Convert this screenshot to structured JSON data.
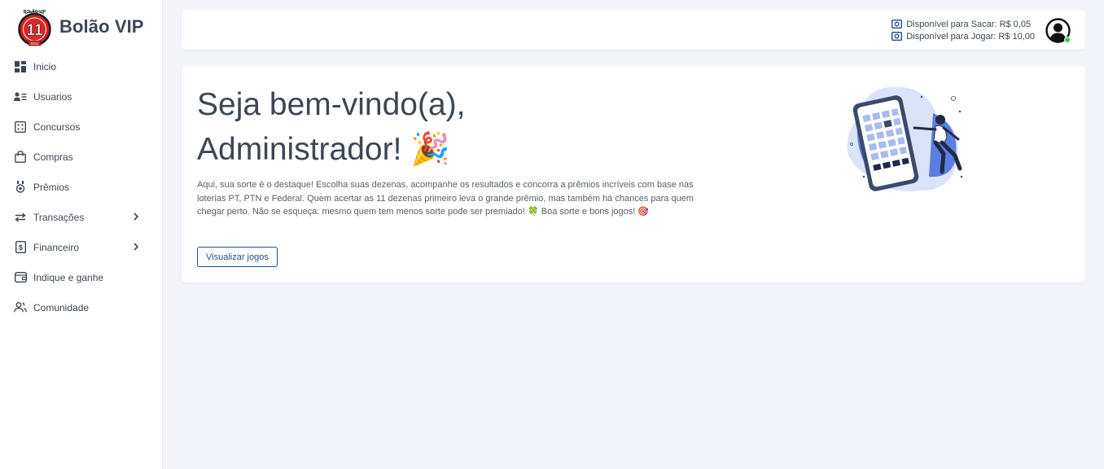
{
  "brand": {
    "name": "Bolão VIP",
    "logo_number": "11",
    "logo_top": "BOLÃO VIP",
    "logo_bottom": "DEZ"
  },
  "sidebar": {
    "items": [
      {
        "label": "Inicio",
        "icon": "dashboard-icon"
      },
      {
        "label": "Usuarios",
        "icon": "users-icon"
      },
      {
        "label": "Concursos",
        "icon": "ticket-icon"
      },
      {
        "label": "Compras",
        "icon": "shopping-bag-icon"
      },
      {
        "label": "Prêmios",
        "icon": "medal-icon"
      },
      {
        "label": "Transações",
        "icon": "arrows-exchange-icon",
        "has_submenu": true
      },
      {
        "label": "Financeiro",
        "icon": "dollar-file-icon",
        "has_submenu": true
      },
      {
        "label": "Indique e ganhe",
        "icon": "wallet-icon"
      },
      {
        "label": "Comunidade",
        "icon": "community-icon"
      }
    ]
  },
  "topbar": {
    "withdraw_label": "Disponível para Sacar: R$ 0,05",
    "play_label": "Disponível para Jogar: R$ 10,00",
    "online_color": "#43c463"
  },
  "welcome": {
    "title_line1": "Seja bem-vindo(a),",
    "title_line2": "Administrador!",
    "title_emoji": "🎉",
    "text_main": "Aqui, sua sorte é o destaque! Escolha suas dezenas, acompanhe os resultados e concorra a prêmios incríveis com base nas loterias PT, PTN e Federal. Quem acertar as 11 dezenas primeiro leva o grande prêmio, mas também há chances para quem chegar perto. Não se esqueça: mesmo quem tem menos sorte pode ser premiado! ",
    "clover": "🍀",
    "text_end": " Boa sorte e bons jogos! ",
    "target": "🎯",
    "button_label": "Visualizar jogos"
  },
  "colors": {
    "accent": "#1f4f8a",
    "text": "#3b4754",
    "background": "#f4f5fa",
    "illustration_blue": "#5b7fe0"
  }
}
